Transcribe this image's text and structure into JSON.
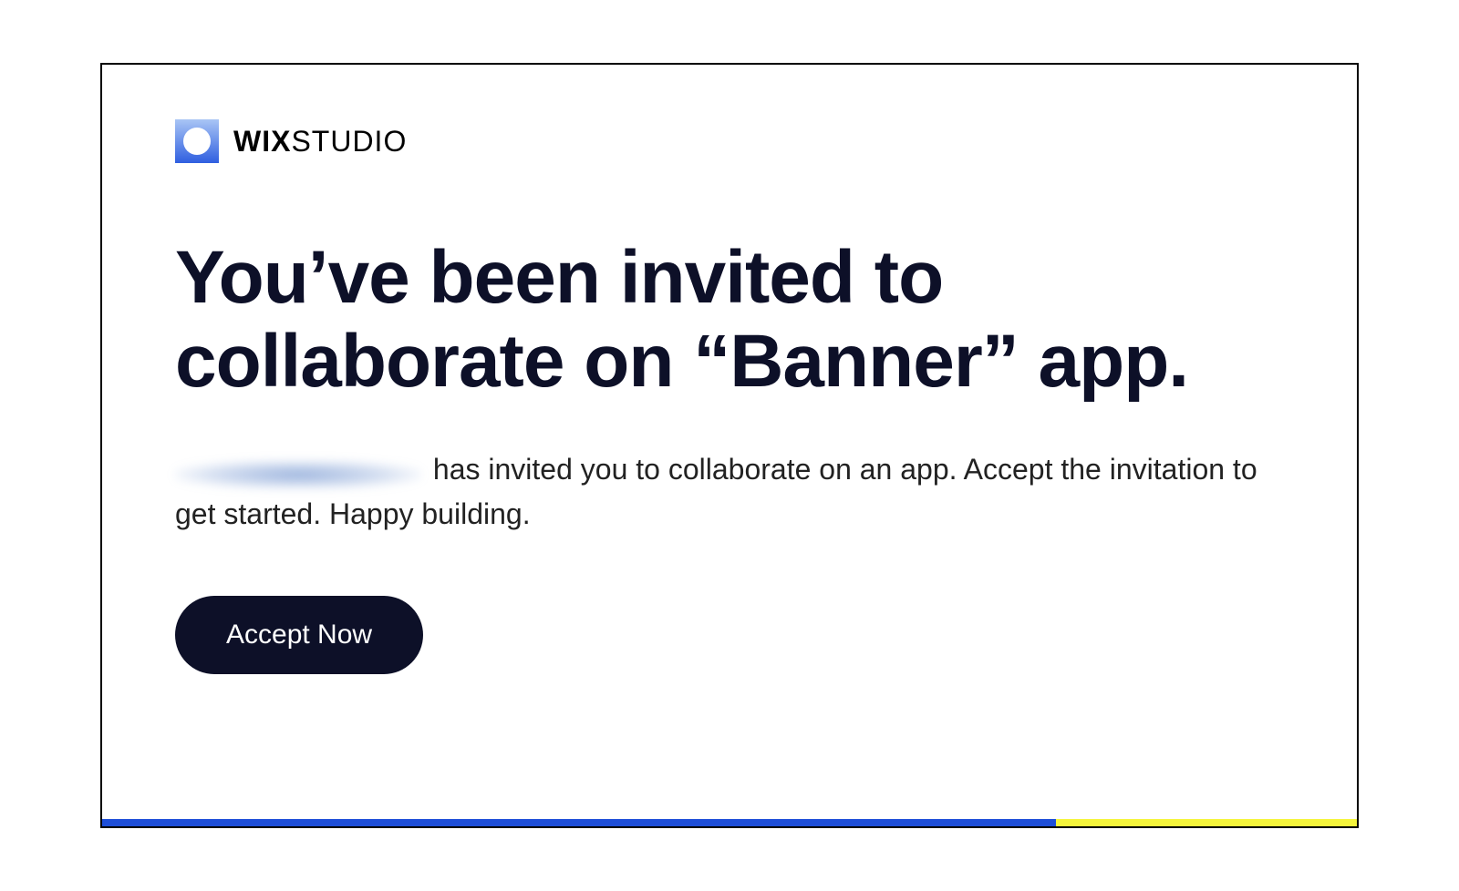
{
  "logo": {
    "word1": "WIX",
    "word2": "STUDIO"
  },
  "heading": "You’ve been invited to collaborate on “Banner” app.",
  "body": {
    "invite_suffix": " has invited you to collaborate on an app. Accept the invitation to get started. Happy building."
  },
  "cta": {
    "label": "Accept Now"
  }
}
